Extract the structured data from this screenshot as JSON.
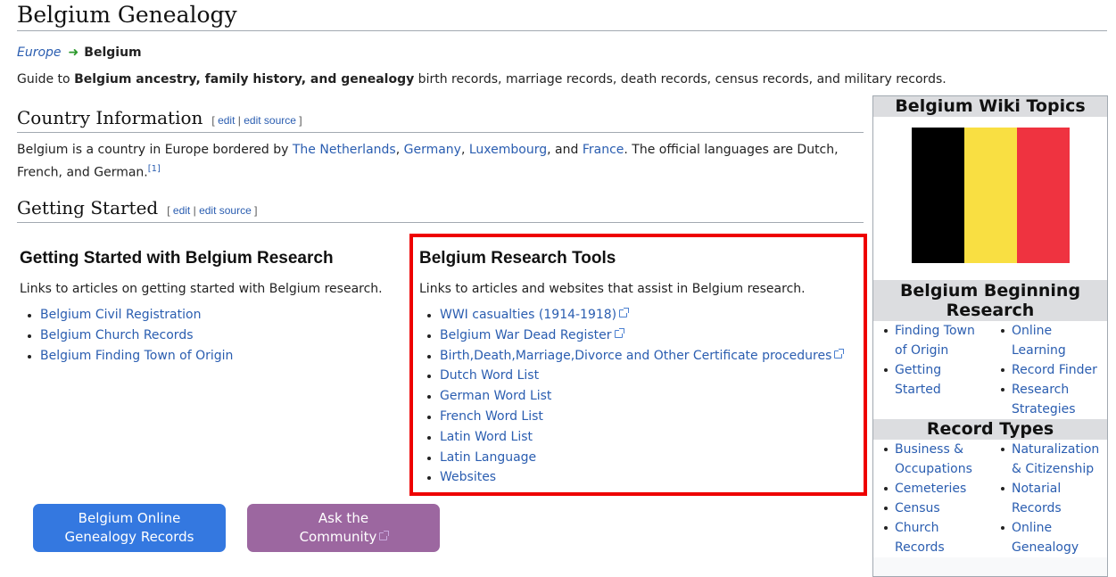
{
  "page": {
    "title": "Belgium Genealogy"
  },
  "breadcrumb": {
    "parent": "Europe",
    "current": "Belgium"
  },
  "intro": {
    "prefix": "Guide to ",
    "bold": "Belgium ancestry, family history, and genealogy",
    "suffix": " birth records, marriage records, death records, census records, and military records."
  },
  "edit": {
    "open": "[ ",
    "edit": "edit",
    "sep": " | ",
    "edit_source": "edit source",
    "close": " ]"
  },
  "country_info": {
    "heading": "Country Information",
    "text_start": "Belgium is a country in Europe bordered by ",
    "links": [
      "The Netherlands",
      "Germany",
      "Luxembourg",
      "France"
    ],
    "comma": ", ",
    "and": ", and ",
    "text_end": ". The official languages are Dutch, French, and German.",
    "ref": "[1]"
  },
  "getting_started": {
    "heading": "Getting Started",
    "left": {
      "heading": "Getting Started with Belgium Research",
      "desc": "Links to articles on getting started with Belgium research.",
      "items": [
        "Belgium Civil Registration",
        "Belgium Church Records",
        "Belgium Finding Town of Origin"
      ]
    },
    "tools": {
      "heading": "Belgium Research Tools",
      "desc": "Links to articles and websites that assist in Belgium research.",
      "items": [
        "WWI casualties (1914-1918)",
        "Belgium War Dead Register",
        "Birth,Death,Marriage,Divorce and Other Certificate procedures",
        "Dutch Word List",
        "German Word List",
        "French Word List",
        "Latin Word List",
        "Latin Language",
        "Websites"
      ]
    }
  },
  "buttons": {
    "online_line1": "Belgium Online",
    "online_line2": "Genealogy Records",
    "ask_line1": "Ask the",
    "ask_line2": "Community"
  },
  "sidebar": {
    "wiki_topics": "Belgium Wiki Topics",
    "flag_colors": [
      "#000000",
      "#f9df42",
      "#ef3340"
    ],
    "beginning_line1": "Belgium Beginning",
    "beginning_line2": "Research",
    "beginning_left": [
      [
        "Finding Town",
        "of Origin"
      ],
      [
        "Getting",
        "Started"
      ]
    ],
    "beginning_right": [
      [
        "Online",
        "Learning"
      ],
      [
        "Record Finder"
      ],
      [
        "Research",
        "Strategies"
      ]
    ],
    "record_types": "Record Types",
    "records_left": [
      [
        "Business &",
        "Occupations"
      ],
      [
        "Cemeteries"
      ],
      [
        "Census"
      ],
      [
        "Church",
        "Records"
      ]
    ],
    "records_right": [
      [
        "Naturalization",
        "& Citizenship"
      ],
      [
        "Notarial",
        "Records"
      ],
      [
        "Online",
        "Genealogy"
      ]
    ]
  },
  "colors": {
    "link": "#2a5db0",
    "highlight_border": "#ee0000",
    "btn_blue": "#3478e0",
    "btn_purple": "#9c67a0"
  }
}
